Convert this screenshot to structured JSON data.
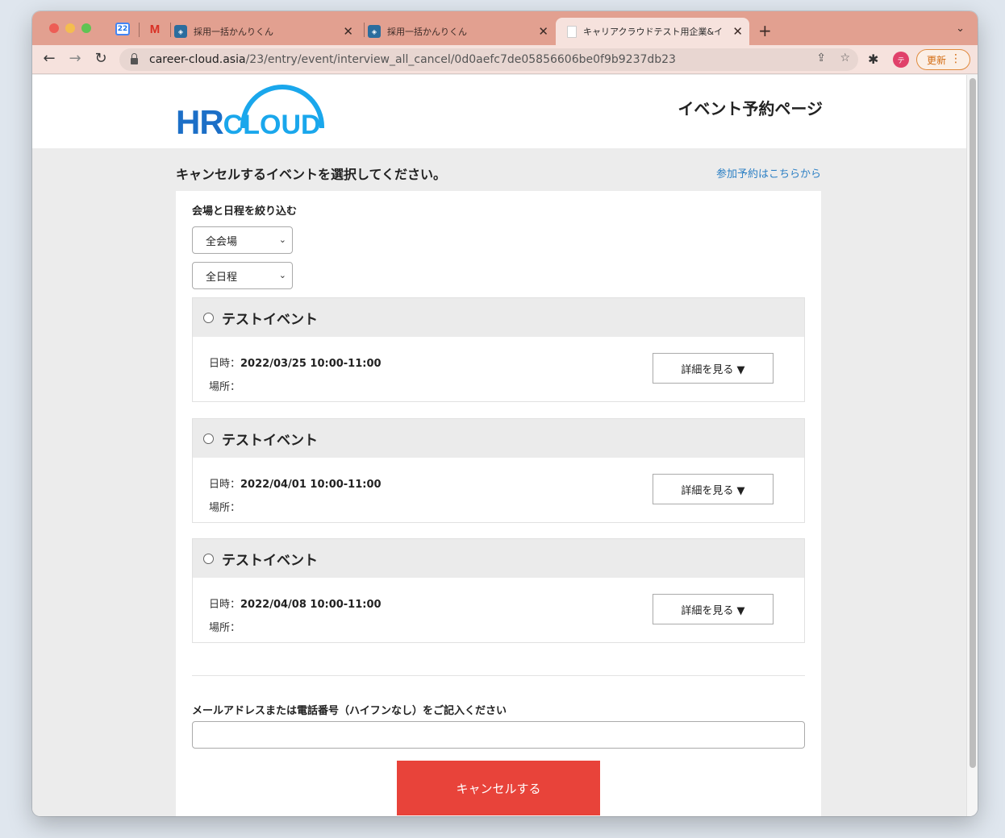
{
  "browser": {
    "tabs": [
      {
        "title": "採用一括かんりくん",
        "favicon": "hr-cloud-icon"
      },
      {
        "title": "採用一括かんりくん",
        "favicon": "hr-cloud-icon"
      },
      {
        "title": "キャリアクラウドテスト用企業&イ",
        "favicon": "document-icon",
        "active": true
      }
    ],
    "pinned_calendar_label": "22",
    "url_host": "career-cloud.asia",
    "url_path": "/23/entry/event/interview_all_cancel/0d0aefc7de05856606be0f9b9237db23",
    "avatar_initial": "テ",
    "update_label": "更新"
  },
  "header": {
    "logo_hr": "HR",
    "logo_cloud": "CLOUD",
    "page_title": "イベント予約ページ"
  },
  "intro": {
    "text": "キャンセルするイベントを選択してください。",
    "join_link": "参加予約はこちらから"
  },
  "filters": {
    "label": "会場と日程を絞り込む",
    "venue_selected": "全会場",
    "date_selected": "全日程"
  },
  "events": [
    {
      "name": "テストイベント",
      "date_label": "日時：",
      "date": "2022/03/25 10:00-11:00",
      "place_label": "場所：",
      "detail_button": "詳細を見る ▼"
    },
    {
      "name": "テストイベント",
      "date_label": "日時：",
      "date": "2022/04/01 10:00-11:00",
      "place_label": "場所：",
      "detail_button": "詳細を見る ▼"
    },
    {
      "name": "テストイベント",
      "date_label": "日時：",
      "date": "2022/04/08 10:00-11:00",
      "place_label": "場所：",
      "detail_button": "詳細を見る ▼"
    }
  ],
  "contact": {
    "label": "メールアドレスまたは電話番号（ハイフンなし）をご記入ください",
    "value": ""
  },
  "cancel_button": "キャンセルする",
  "colors": {
    "tab_strip": "#e2a090",
    "brand_blue": "#1c6fc7",
    "cloud_blue": "#1aa7ec",
    "cancel_red": "#e8433a",
    "link_blue": "#2b7fc4"
  }
}
